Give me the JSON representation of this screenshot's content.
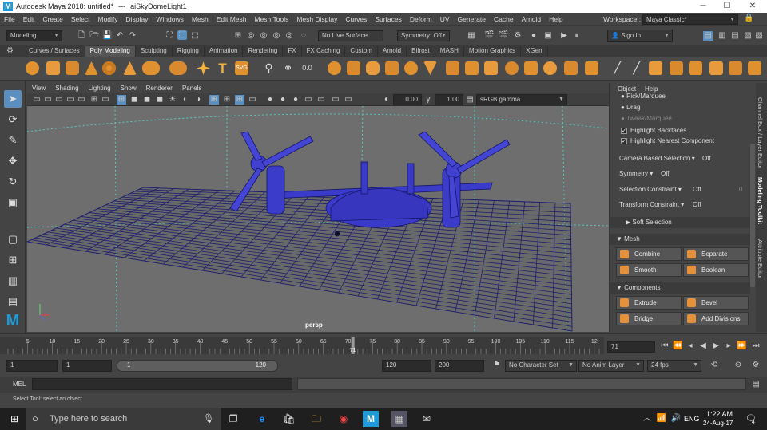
{
  "titlebar": {
    "app": "Autodesk Maya 2018: untitled*",
    "sep": "---",
    "node": "aiSkyDomeLight1",
    "min": "─",
    "max": "☐",
    "close": "✕"
  },
  "menus": [
    "File",
    "Edit",
    "Create",
    "Select",
    "Modify",
    "Display",
    "Windows",
    "Mesh",
    "Edit Mesh",
    "Mesh Tools",
    "Mesh Display",
    "Curves",
    "Surfaces",
    "Deform",
    "UV",
    "Generate",
    "Cache",
    "Arnold",
    "Help"
  ],
  "workspace": {
    "label": "Workspace :",
    "value": "Maya Classic*"
  },
  "statusline": {
    "mode": "Modeling",
    "live": "No Live Surface",
    "symmetry": "Symmetry: Off",
    "signin": "Sign In"
  },
  "shelf_tabs": [
    "Curves / Surfaces",
    "Poly Modeling",
    "Sculpting",
    "Rigging",
    "Animation",
    "Rendering",
    "FX",
    "FX Caching",
    "Custom",
    "Arnold",
    "Bifrost",
    "MASH",
    "Motion Graphics",
    "XGen"
  ],
  "shelf_active": "Poly Modeling",
  "viewport": {
    "menus": [
      "View",
      "Shading",
      "Lighting",
      "Show",
      "Renderer",
      "Panels"
    ],
    "exposure": "0.00",
    "gamma": "1.00",
    "colorspace": "sRGB gamma",
    "camera": "persp"
  },
  "toolkit": {
    "menus": [
      "Object",
      "Help"
    ],
    "pick": "Pick/Marquee",
    "drag": "Drag",
    "tweak": "Tweak/Marquee",
    "hl_backfaces": "Highlight Backfaces",
    "hl_nearest": "Highlight Nearest Component",
    "cam_sel": "Camera Based Selection",
    "cam_sel_val": "Off",
    "symmetry": "Symmetry",
    "symmetry_val": "Off",
    "sel_con": "Selection Constraint",
    "sel_con_val": "Off",
    "sel_con_num": "0",
    "tr_con": "Transform Constraint",
    "tr_con_val": "Off",
    "soft_sel": "Soft Selection",
    "mesh_head": "Mesh",
    "combine": "Combine",
    "separate": "Separate",
    "smooth": "Smooth",
    "boolean": "Boolean",
    "comp_head": "Components",
    "extrude": "Extrude",
    "bevel": "Bevel",
    "bridge": "Bridge",
    "add_div": "Add Divisions"
  },
  "side_tabs": [
    "Channel Box / Layer Editor",
    "Modeling Toolkit",
    "Attribute Editor"
  ],
  "timeline": {
    "ticks": [
      "5",
      "10",
      "15",
      "20",
      "25",
      "30",
      "35",
      "40",
      "45",
      "50",
      "55",
      "60",
      "65",
      "70",
      "75",
      "80",
      "85",
      "90",
      "95",
      "100",
      "105",
      "110",
      "115",
      "12"
    ],
    "current": "71",
    "current_field": "71"
  },
  "range": {
    "start": "1",
    "start2": "1",
    "slider_start": "1",
    "slider_end": "120",
    "end": "120",
    "end2": "200",
    "character": "No Character Set",
    "anim_layer": "No Anim Layer",
    "fps": "24 fps"
  },
  "mel": {
    "label": "MEL"
  },
  "help_line": "Select Tool: select an object",
  "taskbar": {
    "search": "Type here to search",
    "time": "1:22 AM",
    "date": "24-Aug-17",
    "lang": "ENG",
    "notif": "4"
  }
}
